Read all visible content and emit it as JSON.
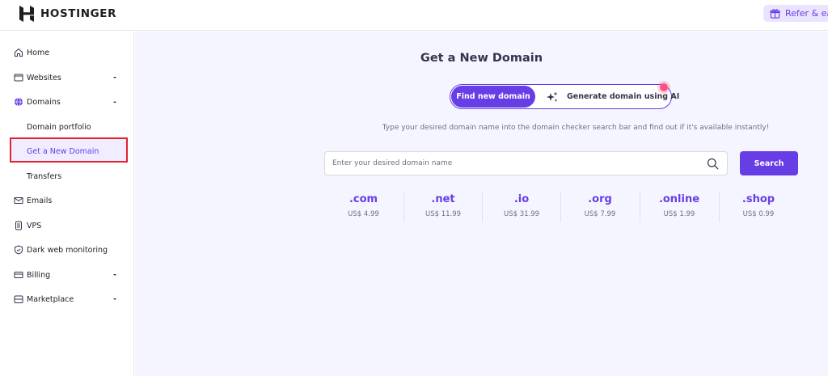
{
  "brand": {
    "name": "HOSTINGER"
  },
  "header": {
    "refer_label": "Refer & earn"
  },
  "sidebar": {
    "items": [
      {
        "label": "Home",
        "icon": "home-icon"
      },
      {
        "label": "Websites",
        "icon": "browser-icon",
        "expandable": true
      },
      {
        "label": "Domains",
        "icon": "globe-icon",
        "expanded": true
      },
      {
        "label": "Domain portfolio",
        "sub": true
      },
      {
        "label": "Get a New Domain",
        "sub": true,
        "active": true
      },
      {
        "label": "Transfers",
        "sub": true
      },
      {
        "label": "Emails",
        "icon": "mail-icon"
      },
      {
        "label": "VPS",
        "icon": "server-icon"
      },
      {
        "label": "Dark web monitoring",
        "icon": "shield-icon"
      },
      {
        "label": "Billing",
        "icon": "credit-card-icon",
        "expandable": true
      },
      {
        "label": "Marketplace",
        "icon": "store-icon",
        "expandable": true
      }
    ]
  },
  "main": {
    "title": "Get a New Domain",
    "toggle": {
      "active_label": "Find new domain",
      "other_label": "Generate domain using AI"
    },
    "subtitle": "Type your desired domain name into the domain checker search bar and find out if it's available instantly!",
    "search": {
      "placeholder": "Enter your desired domain name",
      "button_label": "Search"
    },
    "tlds": [
      {
        "ext": ".com",
        "price": "US$ 4.99"
      },
      {
        "ext": ".net",
        "price": "US$ 11.99"
      },
      {
        "ext": ".io",
        "price": "US$ 31.99"
      },
      {
        "ext": ".org",
        "price": "US$ 7.99"
      },
      {
        "ext": ".online",
        "price": "US$ 1.99"
      },
      {
        "ext": ".shop",
        "price": "US$ 0.99"
      }
    ]
  },
  "colors": {
    "accent": "#673de6",
    "highlight": "#e5202e",
    "background": "#f4f5ff"
  }
}
